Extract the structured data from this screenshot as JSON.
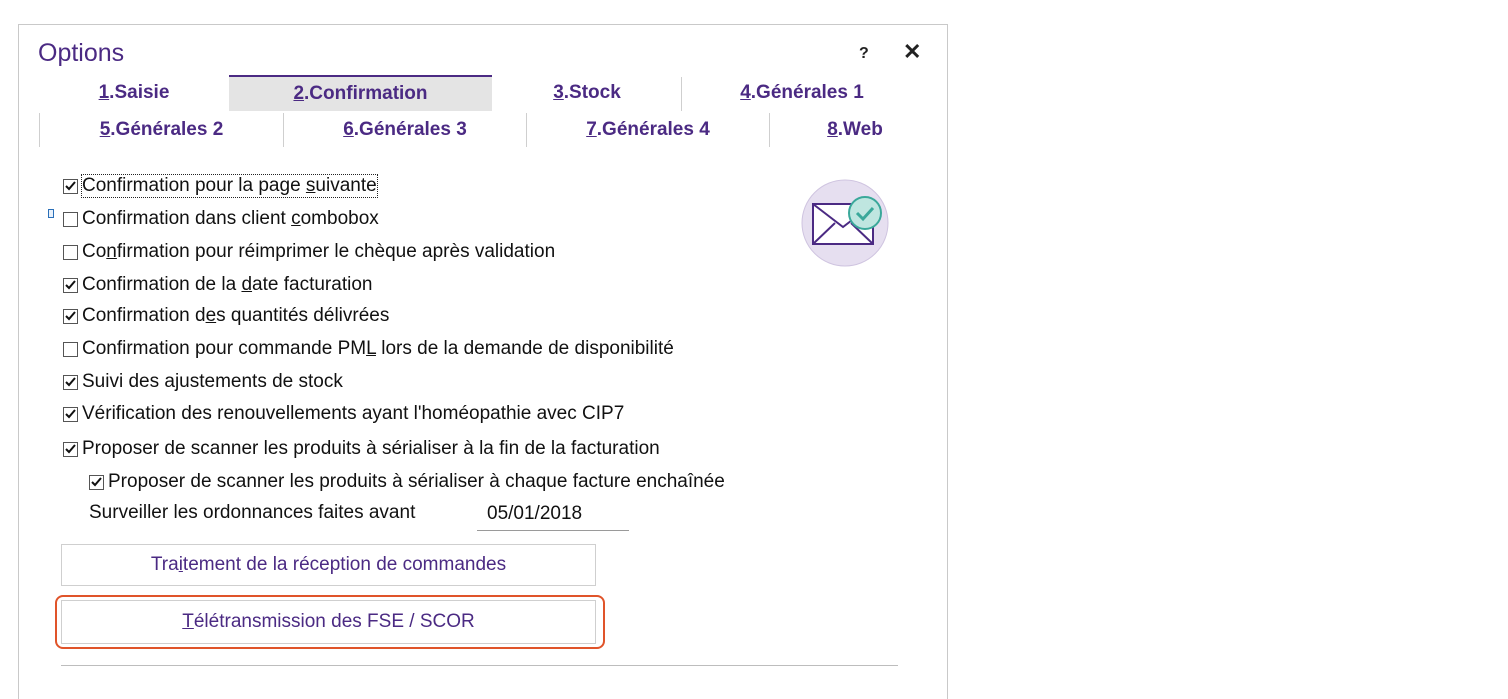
{
  "window": {
    "title": "Options",
    "help_label": "?",
    "close_label": "✕"
  },
  "tabs": [
    {
      "num": "1",
      "label": ".Saisie"
    },
    {
      "num": "2",
      "label": ".Confirmation"
    },
    {
      "num": "3",
      "label": ".Stock"
    },
    {
      "num": "4",
      "label": ".Générales 1"
    },
    {
      "num": "5",
      "label": ".Générales 2"
    },
    {
      "num": "6",
      "label": ".Générales 3"
    },
    {
      "num": "7",
      "label": ".Générales 4"
    },
    {
      "num": "8",
      "label": ".Web"
    }
  ],
  "active_tab": "2.Confirmation",
  "options": [
    {
      "pre": "Confirmation pour la page ",
      "acc": "s",
      "post": "uivante",
      "checked": true
    },
    {
      "pre": "Confirmation dans client ",
      "acc": "c",
      "post": "ombobox",
      "checked": false
    },
    {
      "pre": "Co",
      "acc": "n",
      "post": "firmation pour réimprimer le chèque après validation",
      "checked": false
    },
    {
      "pre": "Confirmation de la ",
      "acc": "d",
      "post": "ate facturation",
      "checked": true
    },
    {
      "pre": "Confirmation d",
      "acc": "e",
      "post": "s quantités délivrées",
      "checked": true
    },
    {
      "pre": "Confirmation pour commande PM",
      "acc": "L",
      "post": " lors de la demande de disponibilité",
      "checked": false
    },
    {
      "pre": "Suivi des ajustements de stock",
      "acc": "",
      "post": "",
      "checked": true
    },
    {
      "pre": "Vérification des renouvellements ayant l'homéopathie avec CIP7",
      "acc": "",
      "post": "",
      "checked": true
    },
    {
      "pre": "Proposer de scanner les produits à sérialiser à la fin de la facturation",
      "acc": "",
      "post": "",
      "checked": true
    },
    {
      "pre": "Proposer de scanner les produits à sérialiser à chaque facture enchaînée",
      "acc": "",
      "post": "",
      "checked": true
    }
  ],
  "surveiller": {
    "label": "Surveiller les ordonnances faites avant",
    "value": "05/01/2018"
  },
  "buttons": {
    "reception": {
      "pre": "Tra",
      "acc": "i",
      "post": "tement de la réception de commandes"
    },
    "teletransmission": {
      "pre": "",
      "acc": "T",
      "post": "élétransmission des FSE / SCOR"
    }
  },
  "colors": {
    "accent": "#4b2a83",
    "highlight": "#e0542a",
    "icon_bg": "#e6dff0",
    "icon_check": "#3aa89a"
  },
  "icons": {
    "decoration": "envelope-check-icon"
  }
}
